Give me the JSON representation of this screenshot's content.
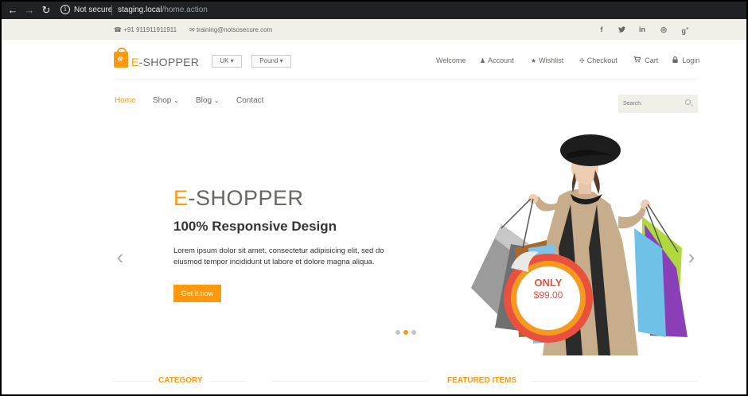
{
  "browser": {
    "security_text": "Not secure",
    "url_host": "staging.local",
    "url_path": "/home.action"
  },
  "header_top": {
    "phone": "+91 911911911911",
    "email": "training@notsosecure.com",
    "social": [
      "facebook-icon",
      "twitter-icon",
      "linkedin-icon",
      "dribbble-icon",
      "google-plus-icon"
    ]
  },
  "logo": {
    "first": "E",
    "rest": "-SHOPPER"
  },
  "dropdowns": {
    "country": "UK",
    "currency": "Pound"
  },
  "account_menu": [
    {
      "label": "Welcome",
      "icon": ""
    },
    {
      "label": "Account",
      "icon": "user-icon"
    },
    {
      "label": "Wishlist",
      "icon": "star-icon"
    },
    {
      "label": "Checkout",
      "icon": "crosshair-icon"
    },
    {
      "label": "Cart",
      "icon": "cart-icon"
    },
    {
      "label": "Login",
      "icon": "lock-icon"
    }
  ],
  "main_nav": {
    "home": "Home",
    "shop": "Shop",
    "blog": "Blog",
    "contact": "Contact"
  },
  "search": {
    "placeholder": "Search"
  },
  "slider": {
    "title_first": "E",
    "title_rest": "-SHOPPER",
    "subtitle": "100% Responsive Design",
    "description": "Lorem ipsum dolor sit amet, consectetur adipisicing elit, sed do eiusmod tempor incididunt ut labore et dolore magna aliqua.",
    "button": "Get it now",
    "badge_line1": "ONLY",
    "badge_line2": "$99.00",
    "active_slide": 2,
    "slide_count": 3
  },
  "sections": {
    "category": "CATEGORY",
    "featured": "FEATURED ITEMS"
  },
  "colors": {
    "accent": "#fe980f",
    "header_bg": "#f0f0e9",
    "text": "#696763"
  }
}
